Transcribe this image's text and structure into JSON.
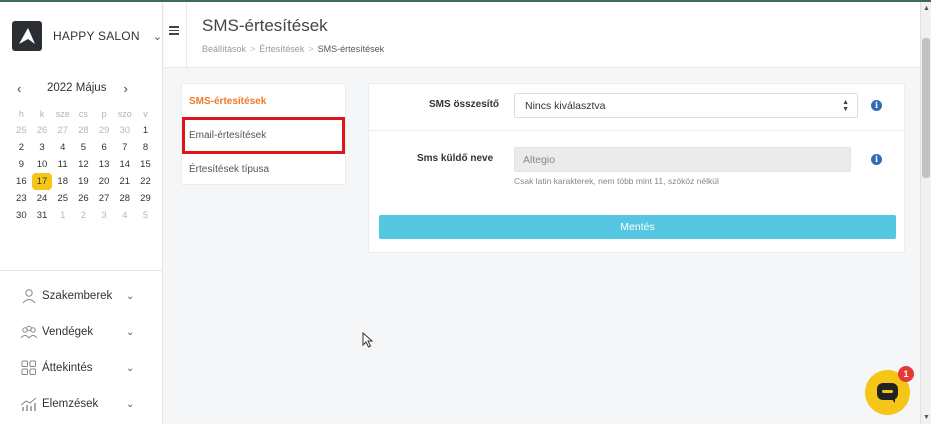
{
  "brand": {
    "name": "HAPPY SALON"
  },
  "calendar": {
    "title": "2022 Május",
    "weekdays": [
      "h",
      "k",
      "sze",
      "cs",
      "p",
      "szo",
      "v"
    ],
    "weeks": [
      [
        "25",
        "26",
        "27",
        "28",
        "29",
        "30",
        "1"
      ],
      [
        "2",
        "3",
        "4",
        "5",
        "6",
        "7",
        "8"
      ],
      [
        "9",
        "10",
        "11",
        "12",
        "13",
        "14",
        "15"
      ],
      [
        "16",
        "17",
        "18",
        "19",
        "20",
        "21",
        "22"
      ],
      [
        "23",
        "24",
        "25",
        "26",
        "27",
        "28",
        "29"
      ],
      [
        "30",
        "31",
        "1",
        "2",
        "3",
        "4",
        "5"
      ]
    ],
    "today": "17"
  },
  "nav": {
    "items": [
      {
        "label": "Szakemberek",
        "icon": "person-icon"
      },
      {
        "label": "Vendégek",
        "icon": "people-icon"
      },
      {
        "label": "Áttekintés",
        "icon": "grid-icon"
      },
      {
        "label": "Elemzések",
        "icon": "chart-icon"
      }
    ]
  },
  "header": {
    "title": "SMS-értesítések",
    "breadcrumb": [
      "Beállítások",
      "Értesítések",
      "SMS-értesítések"
    ]
  },
  "subnav": {
    "items": [
      "SMS-értesítések",
      "Email-értesítések",
      "Értesítések típusa"
    ]
  },
  "form": {
    "sms_summary_label": "SMS összesítő",
    "sms_summary_value": "Nincs kiválasztva",
    "sender_label": "Sms küldő neve",
    "sender_value": "Altegio",
    "sender_hint": "Csak latin karakterek, nem több mint 11, szóköz nélkül",
    "save_label": "Mentés"
  },
  "chat": {
    "badge": "1"
  },
  "colors": {
    "accent": "#f07a2a",
    "primary_button": "#56c7e2",
    "today": "#f5c518",
    "highlight": "#e0141b",
    "info": "#2f6db3"
  }
}
